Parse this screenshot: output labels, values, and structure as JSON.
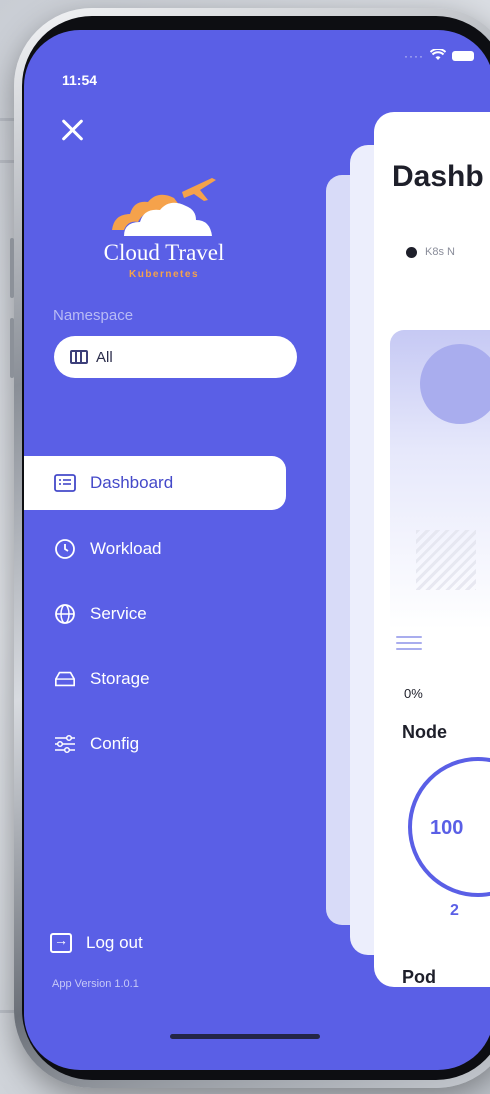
{
  "status_bar": {
    "time": "11:54"
  },
  "drawer": {
    "logo": {
      "title": "Cloud Travel",
      "subtitle": "Kubernetes"
    },
    "namespace": {
      "label": "Namespace",
      "value": "All"
    },
    "menu": [
      {
        "label": "Dashboard",
        "icon": "list-icon",
        "active": true
      },
      {
        "label": "Workload",
        "icon": "history-icon",
        "active": false
      },
      {
        "label": "Service",
        "icon": "globe-icon",
        "active": false
      },
      {
        "label": "Storage",
        "icon": "storage-icon",
        "active": false
      },
      {
        "label": "Config",
        "icon": "sliders-icon",
        "active": false
      }
    ],
    "logout_label": "Log out",
    "version": "App Version 1.0.1"
  },
  "dashboard": {
    "title": "Dashb",
    "cluster_label": "K8s N",
    "percent": "0%",
    "node": {
      "label": "Node",
      "value": "100",
      "count": "2"
    },
    "pod": {
      "label": "Pod"
    }
  },
  "colors": {
    "drawer_bg": "#5a5fe6",
    "accent": "#5a5fe6",
    "logo_orange": "#f5a24b"
  }
}
